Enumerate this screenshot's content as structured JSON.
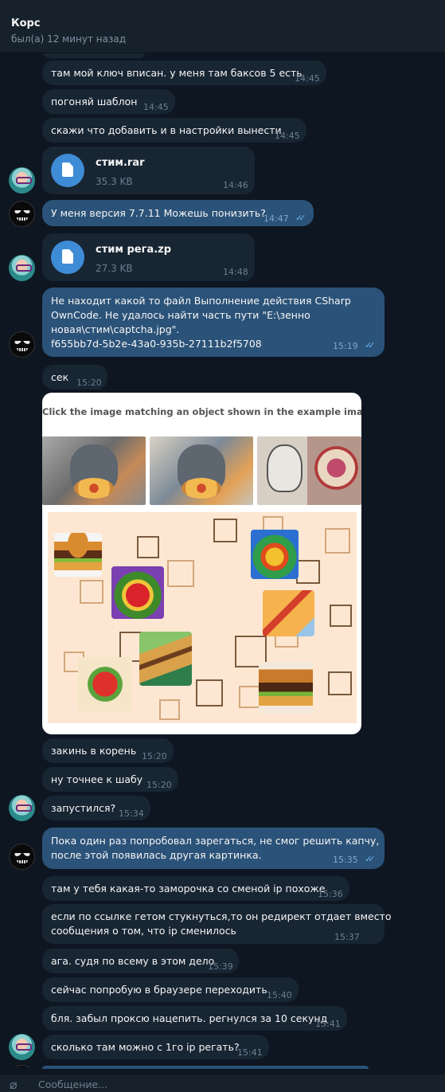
{
  "header": {
    "name": "Корс",
    "status": "был(а) 12 минут назад"
  },
  "messages": [
    {
      "text": "там мой ключ вписан. у меня там баксов 5 есть",
      "time": "14:45"
    },
    {
      "text": "погоняй шаблон",
      "time": "14:45"
    },
    {
      "text": "скажи что добавить и в настройки вынести",
      "time": "14:45"
    },
    {
      "file": "стим.rar",
      "size": "35.3 KB",
      "time": "14:46"
    },
    {
      "text": "У меня версия 7.7.11 Можешь понизить?",
      "time": "14:47"
    },
    {
      "file": "стим рега.zp",
      "size": "27.3 KB",
      "time": "14:48"
    },
    {
      "lines": [
        "Не находит какой то файл Выполнение действия CSharp",
        "OwnCode. Не удалось найти часть пути \"E:\\зенно",
        "новая\\стим\\captcha.jpg\".",
        "f655bb7d-5b2e-43a0-935b-27111b2f5708"
      ],
      "time": "15:19"
    },
    {
      "text": "сек",
      "time": "15:20"
    },
    {
      "image_instruction": "Click the image matching an object shown in the example image."
    },
    {
      "text": "закинь в корень",
      "time": "15:20"
    },
    {
      "text": "ну точнее к шабу",
      "time": "15:20"
    },
    {
      "text": "запустился?",
      "time": "15:34"
    },
    {
      "lines": [
        "Пока один раз попробовал зарегаться, не смог решить капчу,",
        "после этой появилась другая картинка."
      ],
      "time": "15:35"
    },
    {
      "text": "там у тебя какая-то заморочка со сменой ip похоже",
      "time": "15:36"
    },
    {
      "lines": [
        "если по ссылке гетом стукнуться,то он редирект отдает вместо",
        "сообщения о том, что ip сменилось"
      ],
      "time": "15:37"
    },
    {
      "text": "ага. судя по всему в этом дело",
      "time": "15:39"
    },
    {
      "text": "сейчас попробую в браузере переходить",
      "time": "15:40"
    },
    {
      "text": "бля. забыл проксю нацепить. регнулся за 10 секунд",
      "time": "15:41"
    },
    {
      "text": "сколько там можно с 1го ip регать?",
      "time": "15:41"
    }
  ],
  "composer": {
    "placeholder": "Сообщение..."
  },
  "icons": {
    "attach": "paperclip-icon",
    "file": "file-icon",
    "read": "double-check-icon"
  },
  "colors": {
    "background": "#0e1621",
    "incoming": "#182533",
    "outgoing": "#2b5278",
    "accent": "#3f8cd6"
  }
}
